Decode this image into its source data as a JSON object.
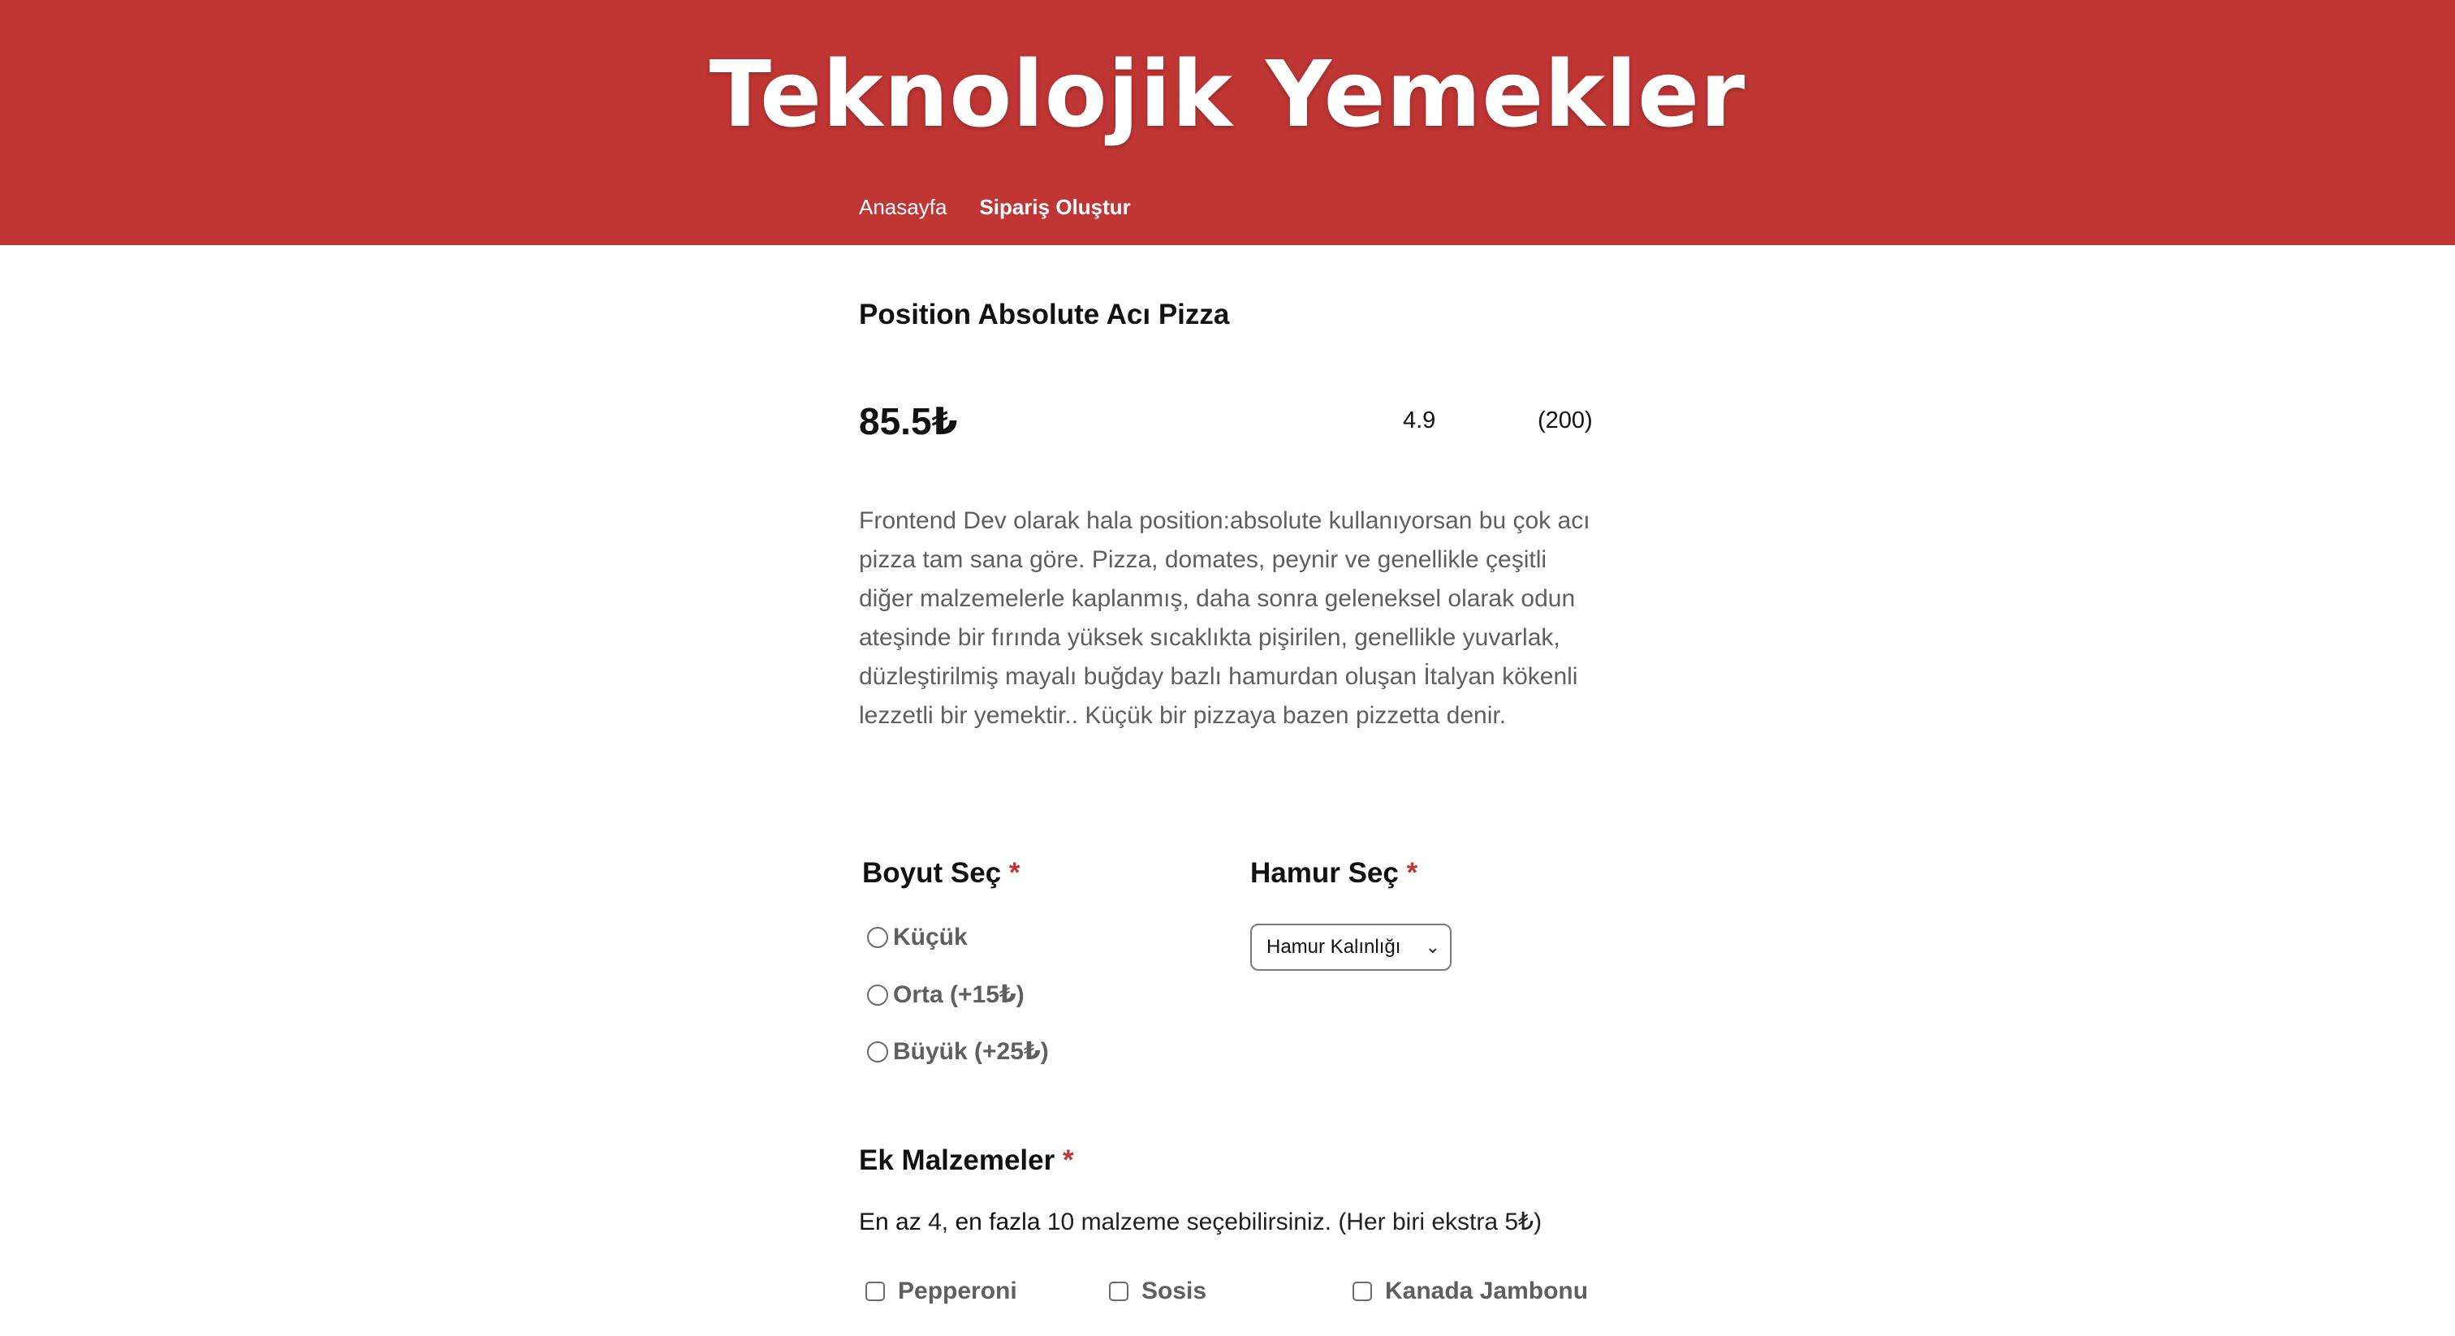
{
  "header": {
    "brand": "Teknolojik Yemekler",
    "nav": [
      {
        "label": "Anasayfa"
      },
      {
        "label": "Sipariş Oluştur"
      }
    ]
  },
  "product": {
    "name": "Position Absolute Acı Pizza",
    "price": "85.5₺",
    "rating": "4.9",
    "reviews": "(200)",
    "description": "Frontend Dev olarak hala position:absolute kullanıyorsan bu çok acı pizza tam sana göre. Pizza, domates, peynir ve genellikle çeşitli diğer malzemelerle kaplanmış, daha sonra geleneksel olarak odun ateşinde bir fırında yüksek sıcaklıkta pişirilen, genellikle yuvarlak, düzleştirilmiş mayalı buğday bazlı hamurdan oluşan İtalyan kökenli lezzetli bir yemektir.. Küçük bir pizzaya bazen pizzetta denir."
  },
  "size": {
    "title": "Boyut Seç",
    "required": "*",
    "options": [
      {
        "label": "Küçük"
      },
      {
        "label": "Orta (+15₺)"
      },
      {
        "label": "Büyük (+25₺)"
      }
    ]
  },
  "dough": {
    "title": "Hamur Seç",
    "required": "*",
    "selected": "Hamur Kalınlığı"
  },
  "extras": {
    "title": "Ek Malzemeler",
    "required": "*",
    "desc_min_label": "En az",
    "desc_min": "4,",
    "desc_max_label": "en fazla",
    "desc_rest": "10 malzeme seçebilirsiniz. (Her biri ekstra 5₺)",
    "items": [
      {
        "label": "Pepperoni"
      },
      {
        "label": "Sosis"
      },
      {
        "label": "Kanada Jambonu"
      }
    ]
  }
}
